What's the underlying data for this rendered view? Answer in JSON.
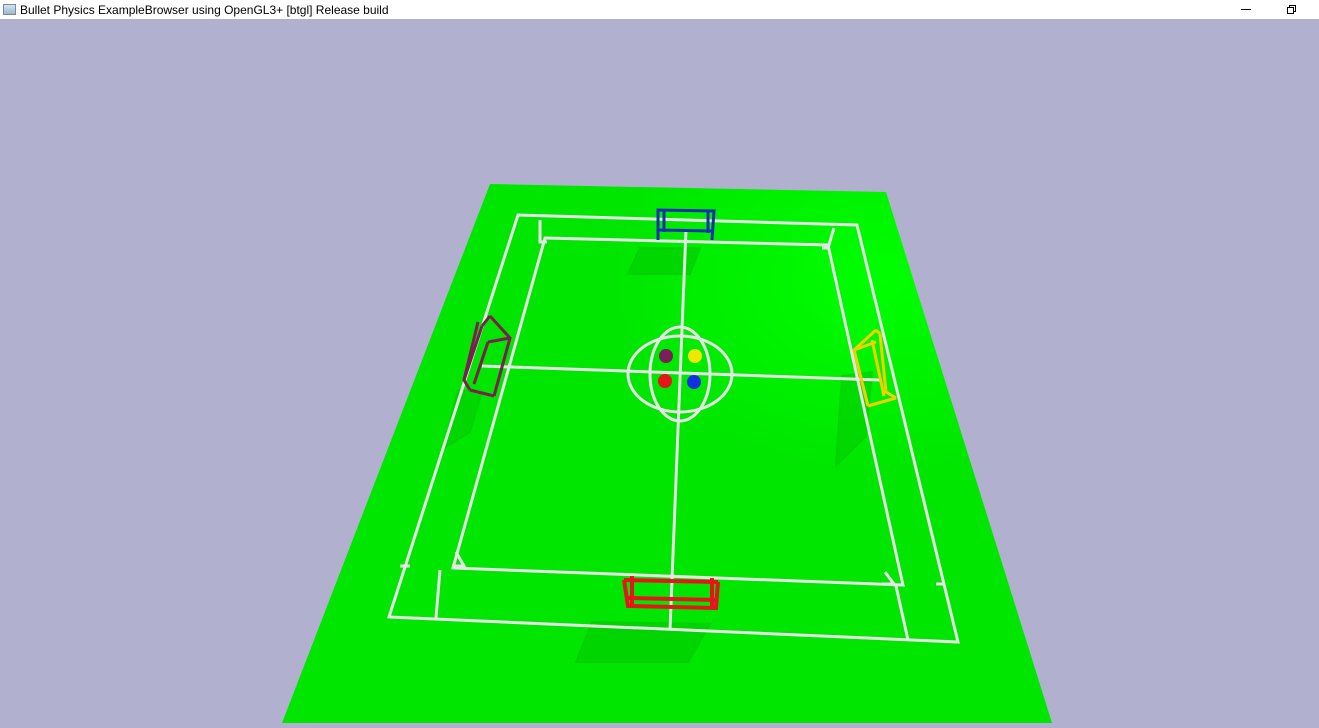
{
  "window": {
    "title": "Bullet Physics ExampleBrowser using OpenGL3+ [btgl] Release build",
    "icon": "app-window-icon",
    "minimize_icon": "minimize-icon",
    "restore_icon": "restore-icon"
  },
  "scene": {
    "background_color": "#b1b1cf",
    "field_color": "#00e600",
    "line_color": "#e6e6e6",
    "goals": [
      {
        "name": "top-goal",
        "color": "#1a2fb0"
      },
      {
        "name": "left-goal",
        "color": "#7a1f4f"
      },
      {
        "name": "right-goal",
        "color": "#f2d000"
      },
      {
        "name": "bottom-goal",
        "color": "#e8141b"
      }
    ],
    "balls": [
      {
        "name": "purple-ball",
        "color": "#7a1f5a"
      },
      {
        "name": "yellow-ball",
        "color": "#f2e600"
      },
      {
        "name": "red-ball",
        "color": "#e8141b"
      },
      {
        "name": "blue-ball",
        "color": "#1230e0"
      }
    ]
  }
}
